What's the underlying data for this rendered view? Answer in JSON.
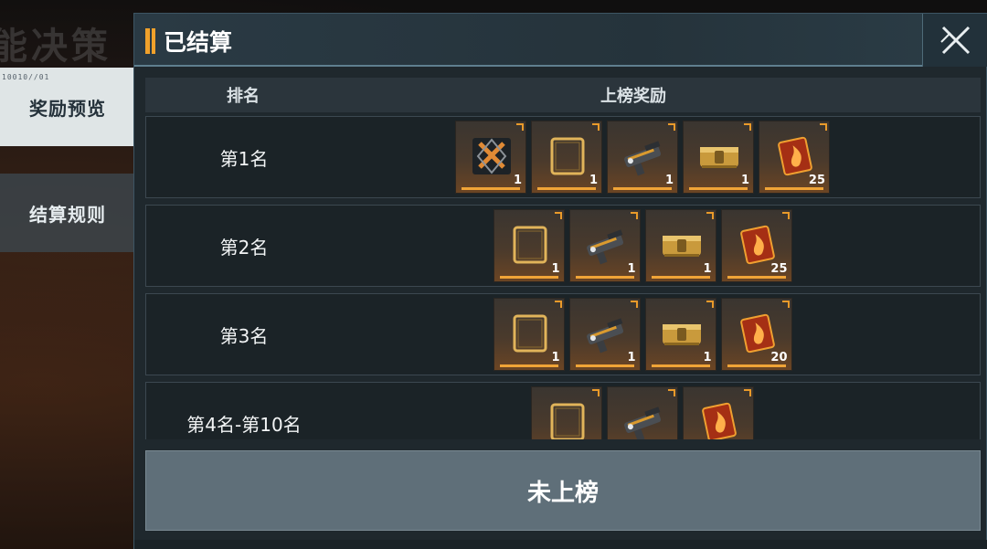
{
  "background": {
    "title_fragment": "能决策"
  },
  "side_tabs": [
    {
      "label": "奖励预览",
      "code": "10010//01",
      "active": true
    },
    {
      "label": "结算规则",
      "active": false
    }
  ],
  "panel": {
    "title": "已结算",
    "close_icon": "close-x-icon",
    "table_header": {
      "rank": "排名",
      "reward": "上榜奖励"
    },
    "rows": [
      {
        "rank": "第1名",
        "items": [
          {
            "icon": "badge-crossed-swords-icon",
            "qty": "1"
          },
          {
            "icon": "frame-icon",
            "qty": "1"
          },
          {
            "icon": "gun-icon",
            "qty": "1"
          },
          {
            "icon": "gold-crate-icon",
            "qty": "1"
          },
          {
            "icon": "fire-card-icon",
            "qty": "25"
          }
        ]
      },
      {
        "rank": "第2名",
        "items": [
          {
            "icon": "frame-icon",
            "qty": "1"
          },
          {
            "icon": "gun-icon",
            "qty": "1"
          },
          {
            "icon": "gold-crate-icon",
            "qty": "1"
          },
          {
            "icon": "fire-card-icon",
            "qty": "25"
          }
        ]
      },
      {
        "rank": "第3名",
        "items": [
          {
            "icon": "frame-icon",
            "qty": "1"
          },
          {
            "icon": "gun-icon",
            "qty": "1"
          },
          {
            "icon": "gold-crate-icon",
            "qty": "1"
          },
          {
            "icon": "fire-card-icon",
            "qty": "20"
          }
        ]
      },
      {
        "rank": "第4名-第10名",
        "items": [
          {
            "icon": "frame-icon",
            "qty": ""
          },
          {
            "icon": "gun-icon",
            "qty": ""
          },
          {
            "icon": "fire-card-icon",
            "qty": ""
          }
        ]
      }
    ],
    "footer_button": "未上榜"
  },
  "colors": {
    "accent": "#f0a437",
    "panel_bg": "#1f282d"
  }
}
